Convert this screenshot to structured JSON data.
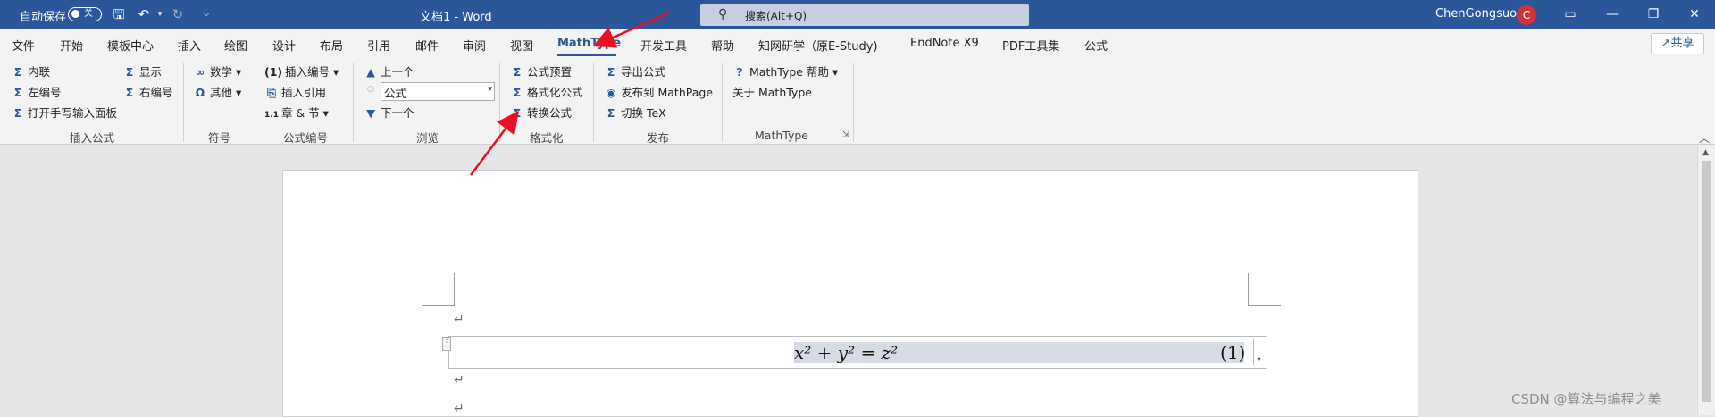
{
  "titlebar": {
    "autosave_label": "自动保存",
    "autosave_state": "关",
    "doc_title": "文档1 - Word",
    "search_placeholder": "搜索(Alt+Q)",
    "user_name": "ChenGongsuo",
    "avatar_letter": "C"
  },
  "tabs": [
    {
      "label": "文件"
    },
    {
      "label": "开始"
    },
    {
      "label": "模板中心"
    },
    {
      "label": "插入"
    },
    {
      "label": "绘图"
    },
    {
      "label": "设计"
    },
    {
      "label": "布局"
    },
    {
      "label": "引用"
    },
    {
      "label": "邮件"
    },
    {
      "label": "审阅"
    },
    {
      "label": "视图"
    },
    {
      "label": "MathType"
    },
    {
      "label": "开发工具"
    },
    {
      "label": "帮助"
    },
    {
      "label": "知网研学（原E-Study)"
    },
    {
      "label": "EndNote X9"
    },
    {
      "label": "PDF工具集"
    },
    {
      "label": "公式"
    }
  ],
  "share_label": "共享",
  "ribbon": {
    "insert_eq": {
      "inline": "内联",
      "show": "显示",
      "left_num": "左编号",
      "right_num": "右编号",
      "handwrite": "打开手写输入面板",
      "group": "插入公式"
    },
    "symbols": {
      "math": "数学",
      "other": "其他",
      "group": "符号"
    },
    "eqnum": {
      "insert_num": "插入编号",
      "insert_ref": "插入引用",
      "chapter": "章 & 节",
      "group": "公式编号"
    },
    "browse": {
      "prev": "上一个",
      "combo_value": "公式",
      "next": "下一个",
      "group": "浏览"
    },
    "format": {
      "preset": "公式预置",
      "format_eq": "格式化公式",
      "convert": "转换公式",
      "group": "格式化"
    },
    "publish": {
      "export": "导出公式",
      "publish_mp": "发布到 MathPage",
      "toggle_tex": "切换 TeX",
      "group": "发布"
    },
    "mathtype": {
      "help": "MathType 帮助",
      "about": "关于 MathType",
      "group": "MathType"
    }
  },
  "equation": {
    "content": "x² + y² = z²",
    "number": "(1)"
  },
  "watermark": "CSDN @算法与编程之美",
  "accent_color": "#2b579a",
  "arrow_color": "#e81123"
}
